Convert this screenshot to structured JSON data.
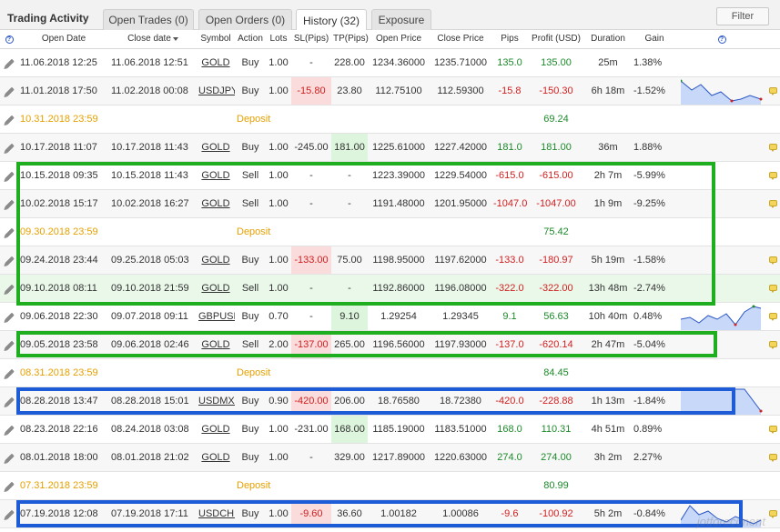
{
  "header": {
    "title": "Trading Activity",
    "tabs": [
      {
        "label": "Open Trades (0)"
      },
      {
        "label": "Open Orders (0)"
      },
      {
        "label": "History (32)"
      },
      {
        "label": "Exposure"
      }
    ],
    "filter_label": "Filter"
  },
  "columns": {
    "help": "?",
    "open_date": "Open Date",
    "close_date": "Close date",
    "symbol": "Symbol",
    "action": "Action",
    "lots": "Lots",
    "sl": "SL(Pips)",
    "tp": "TP(Pips)",
    "open_price": "Open Price",
    "close_price": "Close Price",
    "pips": "Pips",
    "profit": "Profit (USD)",
    "duration": "Duration",
    "gain": "Gain",
    "help2": "?"
  },
  "rows": [
    {
      "open": "11.06.2018 12:25",
      "close": "11.06.2018 12:51",
      "symbol": "GOLD",
      "action": "Buy",
      "lots": "1.00",
      "sl": "-",
      "tp": "228.00",
      "open_price": "1234.36000",
      "close_price": "1235.71000",
      "pips": "135.0",
      "profit": "135.00",
      "duration": "25m",
      "gain": "1.38%"
    },
    {
      "open": "11.01.2018 17:50",
      "close": "11.02.2018 00:08",
      "symbol": "USDJPY",
      "action": "Buy",
      "lots": "1.00",
      "sl": "-15.80",
      "tp": "23.80",
      "open_price": "112.75100",
      "close_price": "112.59300",
      "pips": "-15.8",
      "profit": "-150.30",
      "duration": "6h 18m",
      "gain": "-1.52%"
    },
    {
      "open": "10.31.2018 23:59",
      "deposit": "Deposit",
      "profit": "69.24"
    },
    {
      "open": "10.17.2018 11:07",
      "close": "10.17.2018 11:43",
      "symbol": "GOLD",
      "action": "Buy",
      "lots": "1.00",
      "sl": "-245.00",
      "tp": "181.00",
      "open_price": "1225.61000",
      "close_price": "1227.42000",
      "pips": "181.0",
      "profit": "181.00",
      "duration": "36m",
      "gain": "1.88%"
    },
    {
      "open": "10.15.2018 09:35",
      "close": "10.15.2018 11:43",
      "symbol": "GOLD",
      "action": "Sell",
      "lots": "1.00",
      "sl": "-",
      "tp": "-",
      "open_price": "1223.39000",
      "close_price": "1229.54000",
      "pips": "-615.0",
      "profit": "-615.00",
      "duration": "2h 7m",
      "gain": "-5.99%"
    },
    {
      "open": "10.02.2018 15:17",
      "close": "10.02.2018 16:27",
      "symbol": "GOLD",
      "action": "Sell",
      "lots": "1.00",
      "sl": "-",
      "tp": "-",
      "open_price": "1191.48000",
      "close_price": "1201.95000",
      "pips": "-1047.0",
      "profit": "-1047.00",
      "duration": "1h 9m",
      "gain": "-9.25%"
    },
    {
      "open": "09.30.2018 23:59",
      "deposit": "Deposit",
      "profit": "75.42"
    },
    {
      "open": "09.24.2018 23:44",
      "close": "09.25.2018 05:03",
      "symbol": "GOLD",
      "action": "Buy",
      "lots": "1.00",
      "sl": "-133.00",
      "tp": "75.00",
      "open_price": "1198.95000",
      "close_price": "1197.62000",
      "pips": "-133.0",
      "profit": "-180.97",
      "duration": "5h 19m",
      "gain": "-1.58%"
    },
    {
      "open": "09.10.2018 08:11",
      "close": "09.10.2018 21:59",
      "symbol": "GOLD",
      "action": "Sell",
      "lots": "1.00",
      "sl": "-",
      "tp": "-",
      "open_price": "1192.86000",
      "close_price": "1196.08000",
      "pips": "-322.0",
      "profit": "-322.00",
      "duration": "13h 48m",
      "gain": "-2.74%"
    },
    {
      "open": "09.06.2018 22:30",
      "close": "09.07.2018 09:11",
      "symbol": "GBPUSD",
      "action": "Buy",
      "lots": "0.70",
      "sl": "-",
      "tp": "9.10",
      "open_price": "1.29254",
      "close_price": "1.29345",
      "pips": "9.1",
      "profit": "56.63",
      "duration": "10h 40m",
      "gain": "0.48%"
    },
    {
      "open": "09.05.2018 23:58",
      "close": "09.06.2018 02:46",
      "symbol": "GOLD",
      "action": "Sell",
      "lots": "2.00",
      "sl": "-137.00",
      "tp": "265.00",
      "open_price": "1196.56000",
      "close_price": "1197.93000",
      "pips": "-137.0",
      "profit": "-620.14",
      "duration": "2h 47m",
      "gain": "-5.04%"
    },
    {
      "open": "08.31.2018 23:59",
      "deposit": "Deposit",
      "profit": "84.45"
    },
    {
      "open": "08.28.2018 13:47",
      "close": "08.28.2018 15:01",
      "symbol": "USDMXN",
      "action": "Buy",
      "lots": "0.90",
      "sl": "-420.00",
      "tp": "206.00",
      "open_price": "18.76580",
      "close_price": "18.72380",
      "pips": "-420.0",
      "profit": "-228.88",
      "duration": "1h 13m",
      "gain": "-1.84%"
    },
    {
      "open": "08.23.2018 22:16",
      "close": "08.24.2018 03:08",
      "symbol": "GOLD",
      "action": "Buy",
      "lots": "1.00",
      "sl": "-231.00",
      "tp": "168.00",
      "open_price": "1185.19000",
      "close_price": "1183.51000",
      "pips": "168.0",
      "profit": "110.31",
      "duration": "4h 51m",
      "gain": "0.89%"
    },
    {
      "open": "08.01.2018 18:00",
      "close": "08.01.2018 21:02",
      "symbol": "GOLD",
      "action": "Buy",
      "lots": "1.00",
      "sl": "-",
      "tp": "329.00",
      "open_price": "1217.89000",
      "close_price": "1220.63000",
      "pips": "274.0",
      "profit": "274.00",
      "duration": "3h 2m",
      "gain": "2.27%"
    },
    {
      "open": "07.31.2018 23:59",
      "deposit": "Deposit",
      "profit": "80.99"
    },
    {
      "open": "07.19.2018 12:08",
      "close": "07.19.2018 17:11",
      "symbol": "USDCHF",
      "action": "Buy",
      "lots": "1.00",
      "sl": "-9.60",
      "tp": "36.60",
      "open_price": "1.00182",
      "close_price": "1.00086",
      "pips": "-9.6",
      "profit": "-100.92",
      "duration": "5h 2m",
      "gain": "-0.84%"
    }
  ],
  "watermark": "jotforeconent"
}
